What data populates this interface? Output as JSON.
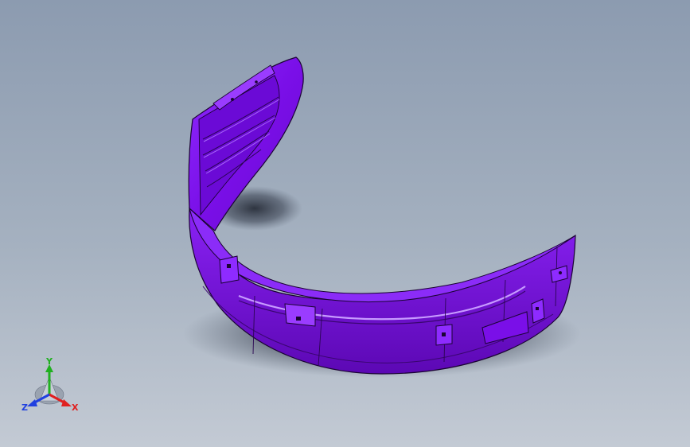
{
  "viewport": {
    "background_top": "#8C9BB0",
    "background_bottom": "#C3CAD4"
  },
  "part": {
    "color": "#7A0FE8",
    "highlight": "#9A3CFF",
    "dark": "#4E0898",
    "edge": "#1B0433"
  },
  "triad": {
    "x_label": "X",
    "y_label": "Y",
    "z_label": "Z",
    "x_color": "#E02020",
    "y_color": "#20B020",
    "z_color": "#2040E0",
    "icon": "coordinate-triad-icon"
  }
}
